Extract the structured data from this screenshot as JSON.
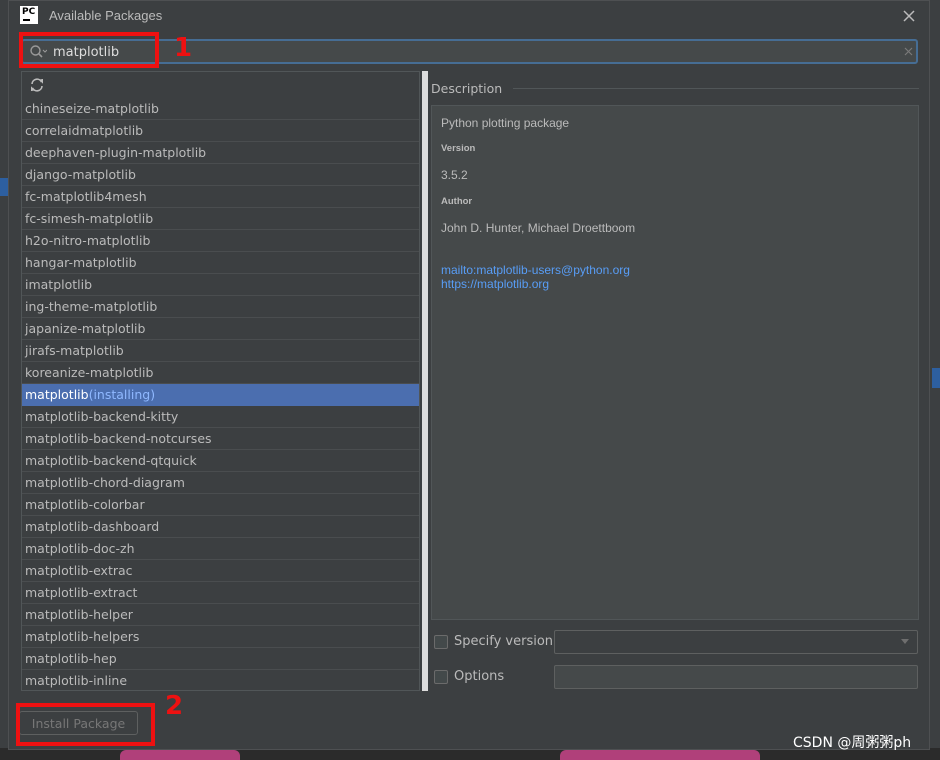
{
  "window": {
    "title": "Available Packages",
    "app_icon_label": "PC"
  },
  "search": {
    "value": "matplotlib",
    "placeholder": ""
  },
  "packages": [
    {
      "name": "chineseize-matplotlib",
      "status": ""
    },
    {
      "name": "correlaidmatplotlib",
      "status": ""
    },
    {
      "name": "deephaven-plugin-matplotlib",
      "status": ""
    },
    {
      "name": "django-matplotlib",
      "status": ""
    },
    {
      "name": "fc-matplotlib4mesh",
      "status": ""
    },
    {
      "name": "fc-simesh-matplotlib",
      "status": ""
    },
    {
      "name": "h2o-nitro-matplotlib",
      "status": ""
    },
    {
      "name": "hangar-matplotlib",
      "status": ""
    },
    {
      "name": "imatplotlib",
      "status": ""
    },
    {
      "name": "ing-theme-matplotlib",
      "status": ""
    },
    {
      "name": "japanize-matplotlib",
      "status": ""
    },
    {
      "name": "jirafs-matplotlib",
      "status": ""
    },
    {
      "name": "koreanize-matplotlib",
      "status": ""
    },
    {
      "name": "matplotlib",
      "status": "(installing)",
      "selected": true
    },
    {
      "name": "matplotlib-backend-kitty",
      "status": ""
    },
    {
      "name": "matplotlib-backend-notcurses",
      "status": ""
    },
    {
      "name": "matplotlib-backend-qtquick",
      "status": ""
    },
    {
      "name": "matplotlib-chord-diagram",
      "status": ""
    },
    {
      "name": "matplotlib-colorbar",
      "status": ""
    },
    {
      "name": "matplotlib-dashboard",
      "status": ""
    },
    {
      "name": "matplotlib-doc-zh",
      "status": ""
    },
    {
      "name": "matplotlib-extrac",
      "status": ""
    },
    {
      "name": "matplotlib-extract",
      "status": ""
    },
    {
      "name": "matplotlib-helper",
      "status": ""
    },
    {
      "name": "matplotlib-helpers",
      "status": ""
    },
    {
      "name": "matplotlib-hep",
      "status": ""
    },
    {
      "name": "matplotlib-inline",
      "status": ""
    }
  ],
  "description": {
    "label": "Description",
    "summary": "Python plotting package",
    "version_label": "Version",
    "version": "3.5.2",
    "author_label": "Author",
    "author": "John D. Hunter, Michael Droettboom",
    "email_link": "mailto:matplotlib-users@python.org",
    "homepage_link": "https://matplotlib.org"
  },
  "options": {
    "specify_version_label": "Specify version",
    "options_label": "Options"
  },
  "install_button": {
    "label": "Install Package"
  },
  "annotations": {
    "one": "1",
    "two": "2"
  },
  "watermark": "CSDN @周粥粥ph",
  "colors": {
    "selection": "#4b6eaf",
    "link": "#589df6",
    "annotation": "#ee1111",
    "focus_border": "#466d94"
  },
  "icons": {
    "search": "search-icon",
    "refresh": "refresh-icon",
    "close": "close-icon",
    "clear": "clear-icon"
  }
}
